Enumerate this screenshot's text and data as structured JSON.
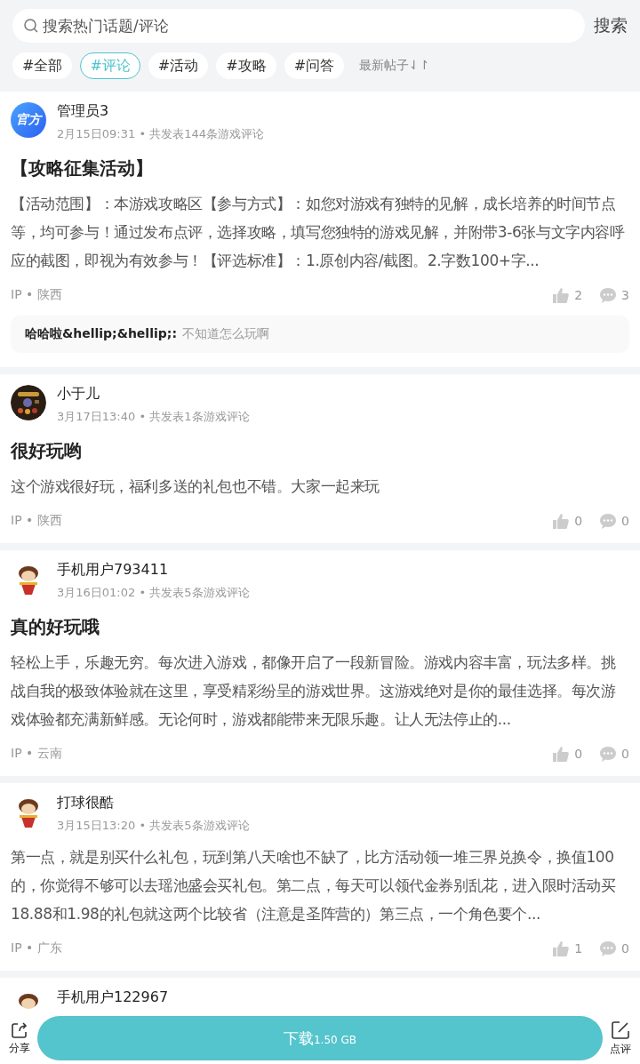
{
  "search": {
    "placeholder": "搜索热门话题/评论",
    "button": "搜索"
  },
  "tags": [
    {
      "label": "#全部",
      "selected": false
    },
    {
      "label": "#评论",
      "selected": true
    },
    {
      "label": "#活动",
      "selected": false
    },
    {
      "label": "#攻略",
      "selected": false
    },
    {
      "label": "#问答",
      "selected": false
    }
  ],
  "sort": {
    "label": "最新帖子",
    "icon": "⇃↾"
  },
  "separator": "•",
  "posts": [
    {
      "avatar": {
        "kind": "official",
        "text": "官方"
      },
      "name": "管理员3",
      "time": "2月15日09:31",
      "meta": "共发表144条游戏评论",
      "title": "【攻略征集活动】",
      "body": "【活动范围】：本游戏攻略区【参与方式】：如您对游戏有独特的见解，成长培养的时间节点等，均可参与！通过发布点评，选择攻略，填写您独特的游戏见解，并附带3-6张与文字内容呼应的截图，即视为有效参与！【评选标准】：1.原创内容/截图。2.字数100+字...",
      "ip": "IP",
      "region": "陕西",
      "likes": "2",
      "comments": "3",
      "reply": {
        "author": "哈哈啦&hellip;&hellip;:",
        "text": "不知道怎么玩啊"
      }
    },
    {
      "name": "小于儿",
      "time": "3月17日13:40",
      "meta": "共发表1条游戏评论",
      "title": "很好玩哟",
      "body": "这个游戏很好玩，福利多送的礼包也不错。大家一起来玩",
      "ip": "IP",
      "region": "陕西",
      "likes": "0",
      "comments": "0"
    },
    {
      "avatar": {
        "kind": "cartoon"
      },
      "name": "手机用户793411",
      "time": "3月16日01:02",
      "meta": "共发表5条游戏评论",
      "title": "真的好玩哦",
      "body": "轻松上手，乐趣无穷。每次进入游戏，都像开启了一段新冒险。游戏内容丰富，玩法多样。挑战自我的极致体验就在这里，享受精彩纷呈的游戏世界。这游戏绝对是你的最佳选择。每次游戏体验都充满新鲜感。无论何时，游戏都能带来无限乐趣。让人无法停止的...",
      "ip": "IP",
      "region": "云南",
      "likes": "0",
      "comments": "0"
    },
    {
      "avatar": {
        "kind": "cartoon"
      },
      "name": "打球很酷",
      "time": "3月15日13:20",
      "meta": "共发表5条游戏评论",
      "body": "第一点，就是别买什么礼包，玩到第八天啥也不缺了，比方活动领一堆三界兑换令，换值100的，你觉得不够可以去瑶池盛会买礼包。第二点，每天可以领代金券别乱花，进入限时活动买18.88和1.98的礼包就这两个比较省（注意是圣阵营的）第三点，一个角色要个...",
      "ip": "IP",
      "region": "广东",
      "likes": "1",
      "comments": "0"
    },
    {
      "avatar": {
        "kind": "cartoon"
      },
      "name": "手机用户122967"
    }
  ],
  "bottom": {
    "share": "分享",
    "download": "下载",
    "size": "1.50 GB",
    "review": "点评"
  }
}
